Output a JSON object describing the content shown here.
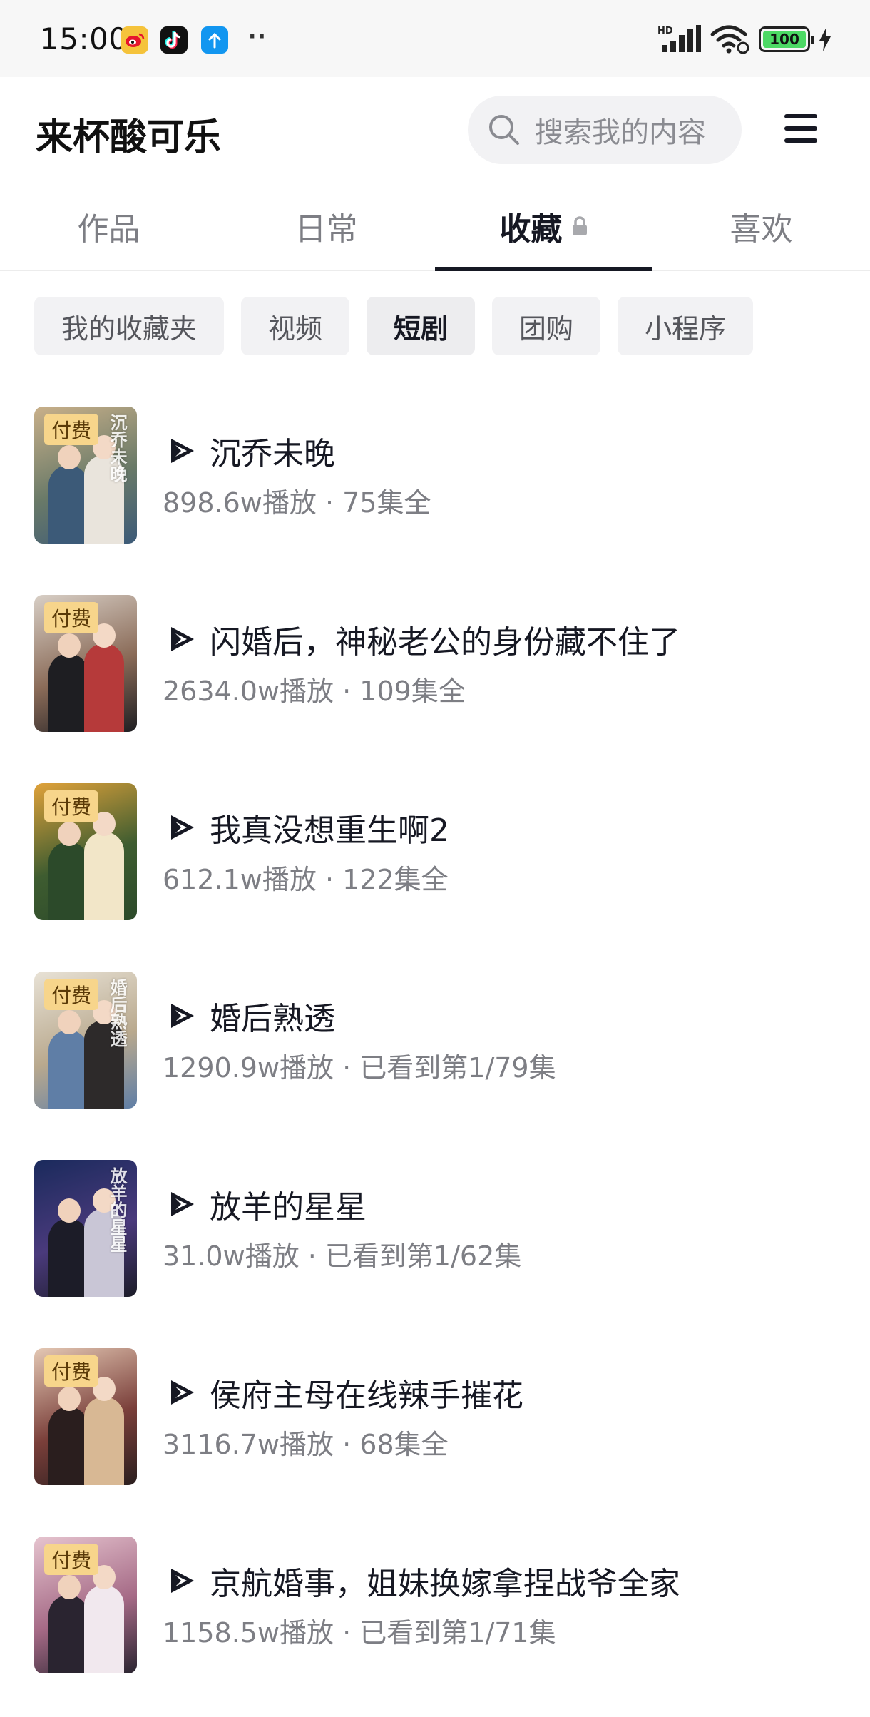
{
  "status_bar": {
    "time": "15:00",
    "signal_label": "HD",
    "battery": "100"
  },
  "header": {
    "profile_name": "来杯酸可乐",
    "search_placeholder": "搜索我的内容"
  },
  "tabs": [
    {
      "label": "作品"
    },
    {
      "label": "日常"
    },
    {
      "label": "收藏",
      "active": true,
      "locked": true
    },
    {
      "label": "喜欢"
    }
  ],
  "chips": [
    {
      "label": "我的收藏夹"
    },
    {
      "label": "视频"
    },
    {
      "label": "短剧",
      "active": true
    },
    {
      "label": "团购"
    },
    {
      "label": "小程序"
    }
  ],
  "items": [
    {
      "title": "沉乔未晚",
      "meta": "898.6w播放 · 75集全",
      "badge": "付费",
      "thumb_title": "沉乔未晚",
      "colors": [
        "#c9b08a",
        "#6a7a68",
        "#3c5a78",
        "#e9e4dc"
      ]
    },
    {
      "title": "闪婚后，神秘老公的身份藏不住了",
      "meta": "2634.0w播放 · 109集全",
      "badge": "付费",
      "thumb_title": "",
      "colors": [
        "#d8cfc6",
        "#8a6b58",
        "#1e1e22",
        "#b63a3a"
      ]
    },
    {
      "title": "我真没想重生啊2",
      "meta": "612.1w播放 · 122集全",
      "badge": "付费",
      "thumb_title": "",
      "colors": [
        "#e0a23a",
        "#3e5c30",
        "#2c4a2a",
        "#f2e6c8"
      ]
    },
    {
      "title": "婚后熟透",
      "meta": "1290.9w播放 · 已看到第1/79集",
      "badge": "付费",
      "thumb_title": "婚后熟透",
      "colors": [
        "#e8e2d6",
        "#b9a98e",
        "#5f7ea6",
        "#2d2a2a"
      ]
    },
    {
      "title": "放羊的星星",
      "meta": "31.0w播放 · 已看到第1/62集",
      "badge": "",
      "thumb_title": "放羊的星星",
      "colors": [
        "#1a2a5c",
        "#4a3a7c",
        "#1c1c28",
        "#c9c6d6"
      ]
    },
    {
      "title": "侯府主母在线辣手摧花",
      "meta": "3116.7w播放 · 68集全",
      "badge": "付费",
      "thumb_title": "",
      "colors": [
        "#e4c8b4",
        "#7a3f3a",
        "#2a1e1e",
        "#d8b894"
      ]
    },
    {
      "title": "京航婚事，姐妹换嫁拿捏战爷全家",
      "meta": "1158.5w播放 · 已看到第1/71集",
      "badge": "付费",
      "thumb_title": "",
      "colors": [
        "#e6c4cf",
        "#a56a86",
        "#2a2430",
        "#f1e8ee"
      ]
    }
  ]
}
